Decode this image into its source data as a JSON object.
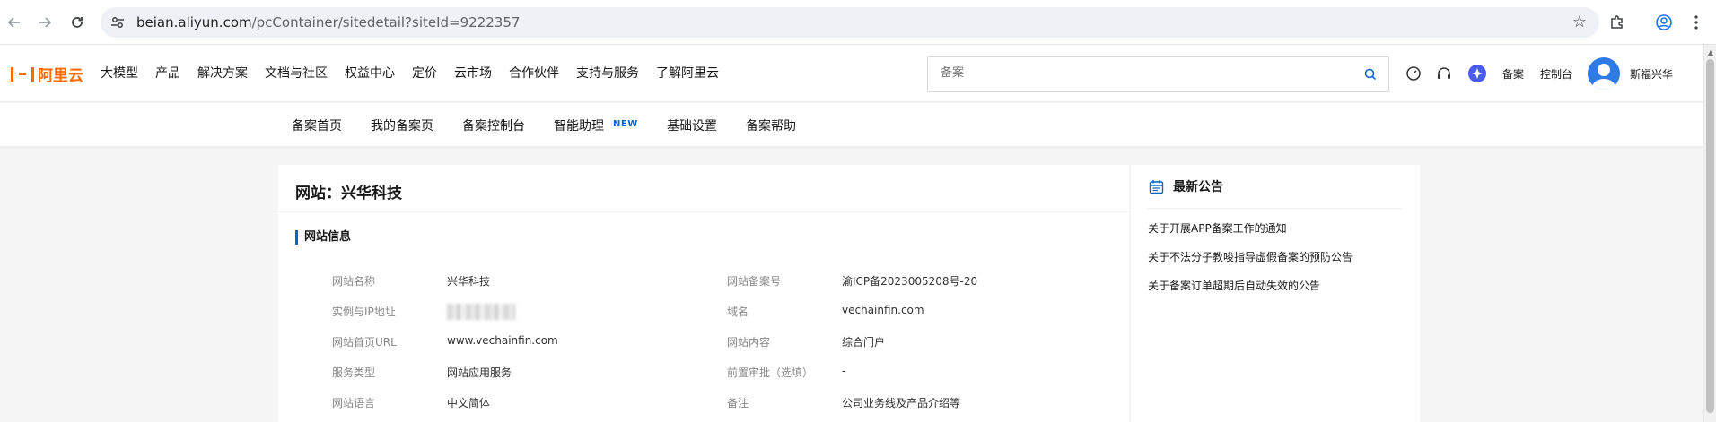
{
  "browser": {
    "url_host": "beian.aliyun.com",
    "url_path": "/pcContainer/sitedetail?siteId=9222357"
  },
  "header": {
    "logo_text": "阿里云",
    "nav": [
      "大模型",
      "产品",
      "解决方案",
      "文档与社区",
      "权益中心",
      "定价",
      "云市场",
      "合作伙伴",
      "支持与服务",
      "了解阿里云"
    ],
    "search_placeholder": "备案",
    "beian_label": "备案",
    "console_label": "控制台",
    "username": "斯福兴华"
  },
  "subnav": {
    "items": [
      "备案首页",
      "我的备案页",
      "备案控制台",
      "智能助理",
      "基础设置",
      "备案帮助"
    ],
    "new_badge": "NEW"
  },
  "site": {
    "title": "网站：兴华科技",
    "section_title": "网站信息",
    "fields_left": [
      {
        "label": "网站名称",
        "value": "兴华科技"
      },
      {
        "label": "实例与IP地址",
        "value": ""
      },
      {
        "label": "网站首页URL",
        "value": "www.vechainfin.com"
      },
      {
        "label": "服务类型",
        "value": "网站应用服务"
      },
      {
        "label": "网站语言",
        "value": "中文简体"
      }
    ],
    "fields_right": [
      {
        "label": "网站备案号",
        "value": "渝ICP备2023005208号-20"
      },
      {
        "label": "域名",
        "value": "vechainfin.com"
      },
      {
        "label": "网站内容",
        "value": "综合门户"
      },
      {
        "label": "前置审批（选填）",
        "value": "-"
      },
      {
        "label": "备注",
        "value": "公司业务线及产品介绍等"
      }
    ]
  },
  "notices": {
    "title": "最新公告",
    "items": [
      "关于开展APP备案工作的通知",
      "关于不法分子教唆指导虚假备案的预防公告",
      "关于备案订单超期后自动失效的公告"
    ]
  },
  "colors": {
    "brand_orange": "#ff6a00",
    "accent_blue": "#0064c8"
  }
}
